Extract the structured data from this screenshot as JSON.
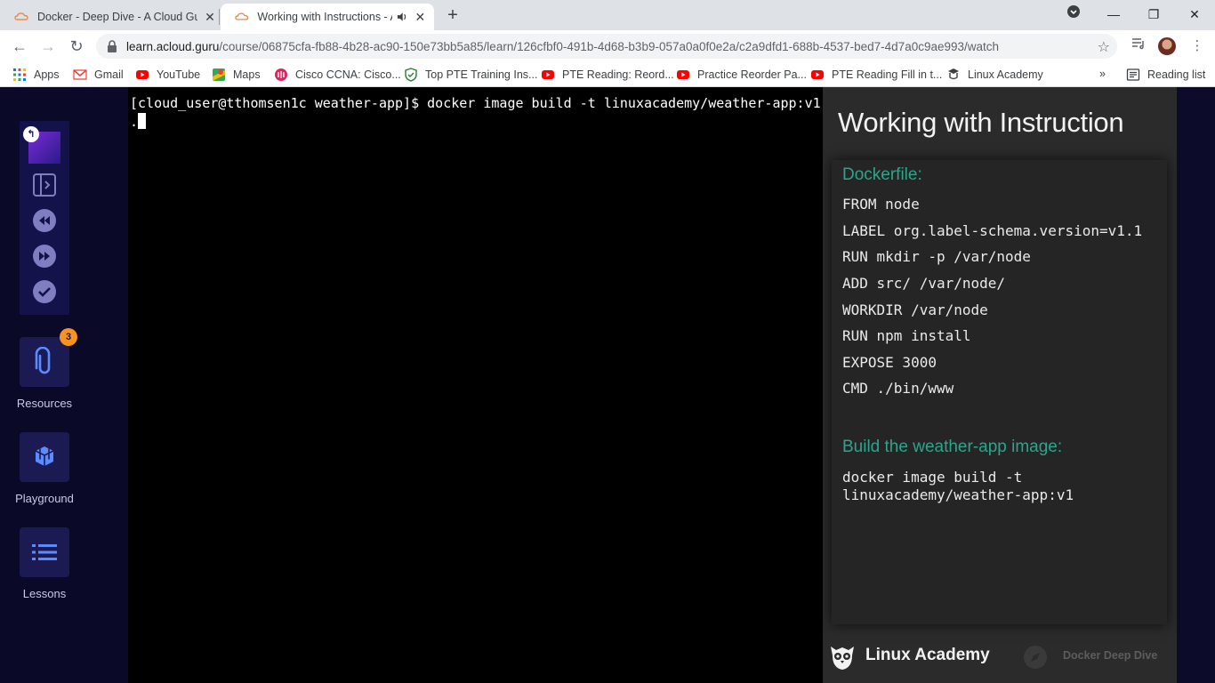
{
  "tabs": [
    {
      "title": "Docker - Deep Dive - A Cloud Guru",
      "active": false
    },
    {
      "title": "Working with Instructions - A Cloud Guru",
      "active": true
    }
  ],
  "address_bar": {
    "host": "learn.acloud.guru",
    "path": "/course/06875cfa-fb88-4b28-ac90-150e73bb5a85/learn/126cfbf0-491b-4d68-b3b9-057a0a0f0e2a/c2a9dfd1-688b-4537-bed7-4d7a0c9ae993/watch"
  },
  "bookmarks": {
    "items": [
      {
        "label": "Apps",
        "icon": "apps-grid-icon"
      },
      {
        "label": "Gmail",
        "icon": "gmail-icon"
      },
      {
        "label": "YouTube",
        "icon": "youtube-icon"
      },
      {
        "label": "Maps",
        "icon": "maps-icon"
      },
      {
        "label": "Cisco CCNA: Cisco...",
        "icon": "cisco-icon"
      },
      {
        "label": "Top PTE Training Ins...",
        "icon": "shield-logo-icon"
      },
      {
        "label": "PTE Reading: Reord...",
        "icon": "youtube-icon"
      },
      {
        "label": "Practice Reorder Pa...",
        "icon": "youtube-icon"
      },
      {
        "label": "PTE Reading Fill in t...",
        "icon": "youtube-icon"
      },
      {
        "label": "Linux Academy",
        "icon": "linux-academy-icon"
      }
    ],
    "more": "»",
    "reading_list": "Reading list"
  },
  "sidebar": {
    "resources_label": "Resources",
    "resources_badge": "3",
    "playground_label": "Playground",
    "lessons_label": "Lessons"
  },
  "terminal": {
    "line1": "[cloud_user@tthomsen1c weather-app]$ docker image build -t linuxacademy/weather-app:v1",
    "line2": "."
  },
  "slide": {
    "title": "Working with Instruction",
    "dockerfile_heading": "Dockerfile:",
    "dockerfile_lines": [
      "FROM node",
      "LABEL org.label-schema.version=v1.1",
      "RUN mkdir -p /var/node",
      "ADD src/ /var/node/",
      "WORKDIR /var/node",
      "RUN npm install",
      "EXPOSE 3000",
      "CMD ./bin/www"
    ],
    "build_heading": "Build the weather-app image:",
    "build_lines": [
      "docker image build -t",
      "linuxacademy/weather-app:v1"
    ],
    "brand": "Linux Academy",
    "course": "Docker Deep Dive"
  },
  "colors": {
    "accent_green": "#2ca58d",
    "sidebar_bg": "#0a0928",
    "badge_orange": "#f7931e"
  }
}
